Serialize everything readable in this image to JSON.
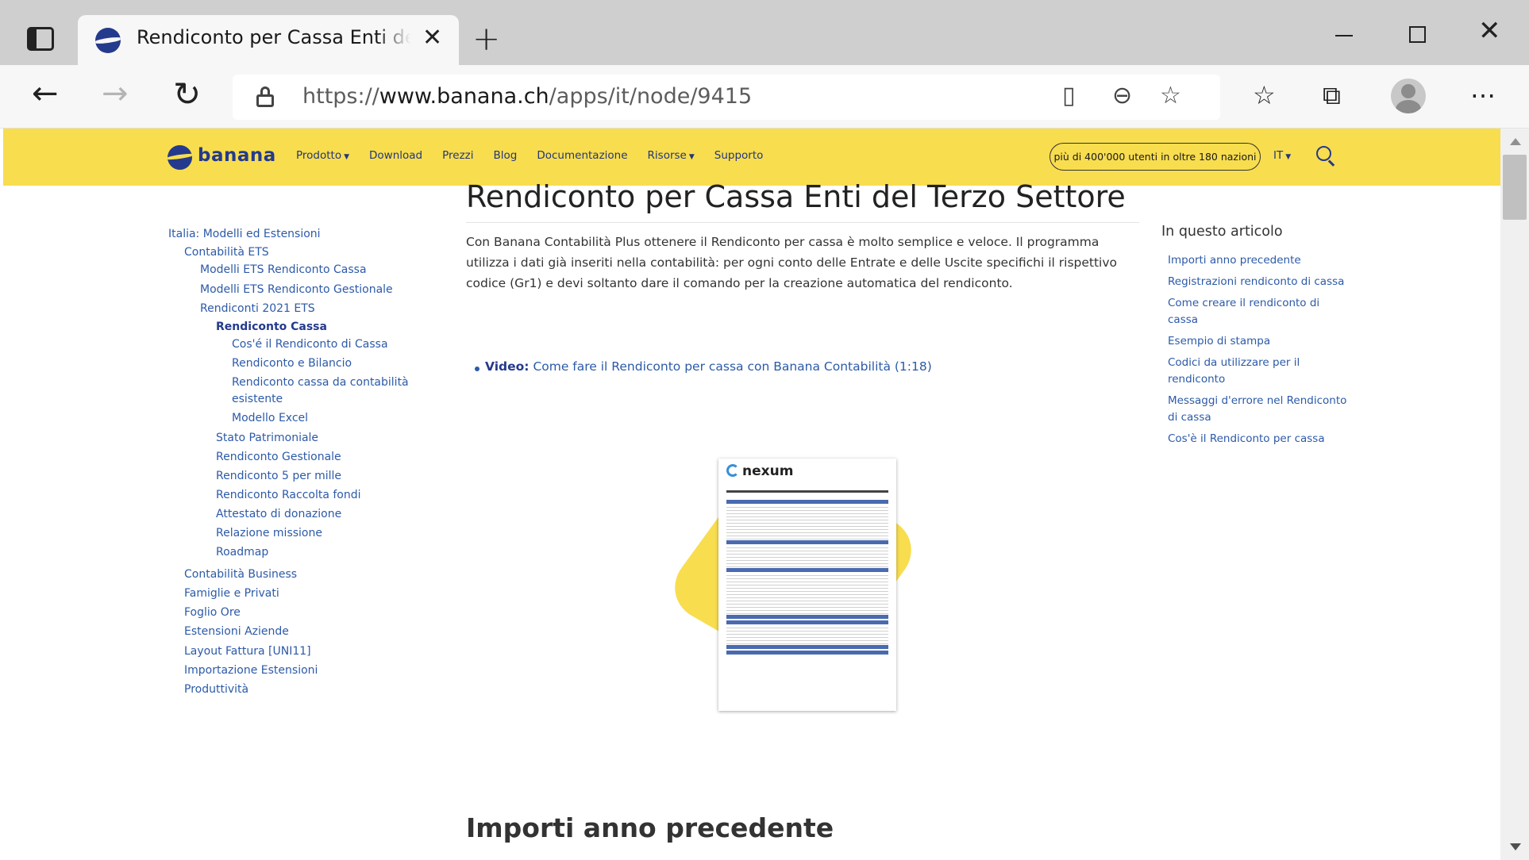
{
  "browser": {
    "tab_title": "Rendiconto per Cassa Enti del Terzo Settore",
    "url_scheme": "https://",
    "url_host": "www.banana.ch",
    "url_path": "/apps/it/node/9415"
  },
  "site": {
    "logo_text": "banana",
    "menu": [
      {
        "label": "Prodotto",
        "dropdown": true
      },
      {
        "label": "Download",
        "dropdown": false
      },
      {
        "label": "Prezzi",
        "dropdown": false
      },
      {
        "label": "Blog",
        "dropdown": false
      },
      {
        "label": "Documentazione",
        "dropdown": false
      },
      {
        "label": "Risorse",
        "dropdown": true
      },
      {
        "label": "Supporto",
        "dropdown": false
      }
    ],
    "users_badge": "più di 400'000 utenti in oltre 180 nazioni",
    "language": "IT",
    "brand_color": "#f8dd4f",
    "link_color": "#2c5aa8"
  },
  "left_nav": [
    {
      "label": "Italia: Modelli ed Estensioni",
      "level": 0
    },
    {
      "label": "Contabilità ETS",
      "level": 1
    },
    {
      "label": "Modelli ETS Rendiconto Cassa",
      "level": 2
    },
    {
      "label": "Modelli ETS Rendiconto Gestionale",
      "level": 2
    },
    {
      "label": "Rendiconti 2021 ETS",
      "level": 2
    },
    {
      "label": "Rendiconto Cassa",
      "level": 3,
      "active": true
    },
    {
      "label": "Cos'é il Rendiconto di Cassa",
      "level": 4
    },
    {
      "label": "Rendiconto e Bilancio",
      "level": 4
    },
    {
      "label": "Rendiconto cassa da contabilità",
      "level": 4
    },
    {
      "label": "esistente",
      "level": 4
    },
    {
      "label": "Modello Excel",
      "level": 4
    },
    {
      "label": "Stato Patrimoniale",
      "level": 3
    },
    {
      "label": "Rendiconto Gestionale",
      "level": 3
    },
    {
      "label": "Rendiconto 5 per mille",
      "level": 3
    },
    {
      "label": "Rendiconto Raccolta fondi",
      "level": 3
    },
    {
      "label": "Attestato di donazione",
      "level": 3
    },
    {
      "label": "Relazione missione",
      "level": 3
    },
    {
      "label": "Roadmap",
      "level": 3
    },
    {
      "label": "Contabilità Business",
      "level": 1
    },
    {
      "label": "Famiglie e Privati",
      "level": 1
    },
    {
      "label": "Foglio Ore",
      "level": 1
    },
    {
      "label": "Estensioni Aziende",
      "level": 1
    },
    {
      "label": "Layout Fattura [UNI11]",
      "level": 1
    },
    {
      "label": "Importazione Estensioni",
      "level": 1
    },
    {
      "label": "Produttività",
      "level": 1
    }
  ],
  "article": {
    "title": "Rendiconto per Cassa Enti del Terzo Settore",
    "intro": "Con Banana Contabilità Plus ottenere il Rendiconto per cassa è molto semplice e veloce. Il programma utilizza i dati già inseriti nella contabilità: per ogni conto delle Entrate e delle Uscite specifichi il rispettivo codice (Gr1) e devi soltanto dare il comando per la creazione automatica del rendiconto.",
    "video_label": "Video:",
    "video_link": "Come fare il Rendiconto per cassa con Banana Contabilità (1:18)",
    "image_logo_text": "nexum",
    "next_section_title": "Importi anno precedente"
  },
  "toc": {
    "title": "In questo articolo",
    "items": [
      [
        "Importi anno precedente"
      ],
      [
        "Registrazioni rendiconto di cassa"
      ],
      [
        "Come creare il rendiconto di",
        "cassa"
      ],
      [
        "Esempio di stampa"
      ],
      [
        "Codici da utilizzare per il",
        "rendiconto"
      ],
      [
        "Messaggi d'errore nel Rendiconto",
        "di cassa"
      ],
      [
        "Cos'è il Rendiconto per cassa"
      ]
    ]
  }
}
